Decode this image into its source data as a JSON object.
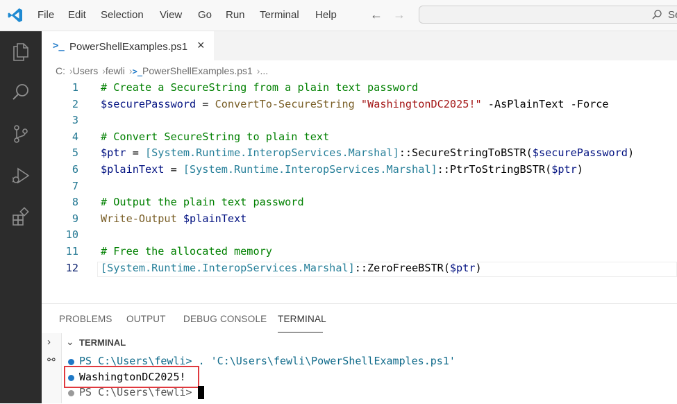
{
  "window": {
    "menu": [
      "File",
      "Edit",
      "Selection",
      "View",
      "Go",
      "Run",
      "Terminal",
      "Help"
    ],
    "search_text": "Se"
  },
  "activity_bar": {
    "icons": [
      "explorer-icon",
      "search-icon",
      "source-control-icon",
      "run-debug-icon",
      "extensions-icon"
    ]
  },
  "tab": {
    "label": "PowerShellExamples.ps1",
    "ps_icon": ">_",
    "close": "×"
  },
  "breadcrumb": {
    "items": [
      "C:",
      "Users",
      "fewli",
      "PowerShellExamples.ps1",
      "..."
    ]
  },
  "editor": {
    "current_line": 12,
    "lines": [
      {
        "n": "1",
        "tokens": [
          {
            "t": "# Create a SecureString from a plain text password",
            "c": "c-comment"
          }
        ]
      },
      {
        "n": "2",
        "tokens": [
          {
            "t": "$securePassword",
            "c": "c-var"
          },
          {
            "t": " = ",
            "c": "c-plain"
          },
          {
            "t": "ConvertTo-SecureString",
            "c": "c-cmd"
          },
          {
            "t": " ",
            "c": "c-plain"
          },
          {
            "t": "\"WashingtonDC2025!\"",
            "c": "c-str"
          },
          {
            "t": " -AsPlainText -Force",
            "c": "c-param"
          }
        ]
      },
      {
        "n": "3",
        "tokens": []
      },
      {
        "n": "4",
        "tokens": [
          {
            "t": "# Convert SecureString to plain text",
            "c": "c-comment"
          }
        ]
      },
      {
        "n": "5",
        "tokens": [
          {
            "t": "$ptr",
            "c": "c-var"
          },
          {
            "t": " = ",
            "c": "c-plain"
          },
          {
            "t": "[System.Runtime.InteropServices.Marshal]",
            "c": "c-type"
          },
          {
            "t": "::SecureStringToBSTR(",
            "c": "c-plain"
          },
          {
            "t": "$securePassword",
            "c": "c-var"
          },
          {
            "t": ")",
            "c": "c-plain"
          }
        ]
      },
      {
        "n": "6",
        "tokens": [
          {
            "t": "$plainText",
            "c": "c-var"
          },
          {
            "t": " = ",
            "c": "c-plain"
          },
          {
            "t": "[System.Runtime.InteropServices.Marshal]",
            "c": "c-type"
          },
          {
            "t": "::PtrToStringBSTR(",
            "c": "c-plain"
          },
          {
            "t": "$ptr",
            "c": "c-var"
          },
          {
            "t": ")",
            "c": "c-plain"
          }
        ]
      },
      {
        "n": "7",
        "tokens": []
      },
      {
        "n": "8",
        "tokens": [
          {
            "t": "# Output the plain text password",
            "c": "c-comment"
          }
        ]
      },
      {
        "n": "9",
        "tokens": [
          {
            "t": "Write-Output",
            "c": "c-cmd"
          },
          {
            "t": " ",
            "c": "c-plain"
          },
          {
            "t": "$plainText",
            "c": "c-var"
          }
        ]
      },
      {
        "n": "10",
        "tokens": []
      },
      {
        "n": "11",
        "tokens": [
          {
            "t": "# Free the allocated memory",
            "c": "c-comment"
          }
        ]
      },
      {
        "n": "12",
        "tokens": [
          {
            "t": "[System.Runtime.InteropServices.Marshal]",
            "c": "c-type"
          },
          {
            "t": "::ZeroFreeBSTR(",
            "c": "c-plain"
          },
          {
            "t": "$ptr",
            "c": "c-var"
          },
          {
            "t": ")",
            "c": "c-plain"
          }
        ]
      }
    ]
  },
  "panel": {
    "tabs": [
      "PROBLEMS",
      "OUTPUT",
      "DEBUG CONSOLE",
      "TERMINAL"
    ],
    "active_tab": "TERMINAL",
    "terminal_header": "TERMINAL",
    "terminal_lines": [
      {
        "text": "PS C:\\Users\\fewli> . 'C:\\Users\\fewli\\PowerShellExamples.ps1'",
        "dot": "#1f78c6"
      },
      {
        "text": "WashingtonDC2025!",
        "dot": "#1f78c6"
      },
      {
        "text": "PS C:\\Users\\fewli>",
        "dot": "#9a9a9a"
      }
    ]
  },
  "colors": {
    "activity_bar": "#2c2c2c",
    "accent": "#1e79c8",
    "highlight": "#e0393e"
  }
}
